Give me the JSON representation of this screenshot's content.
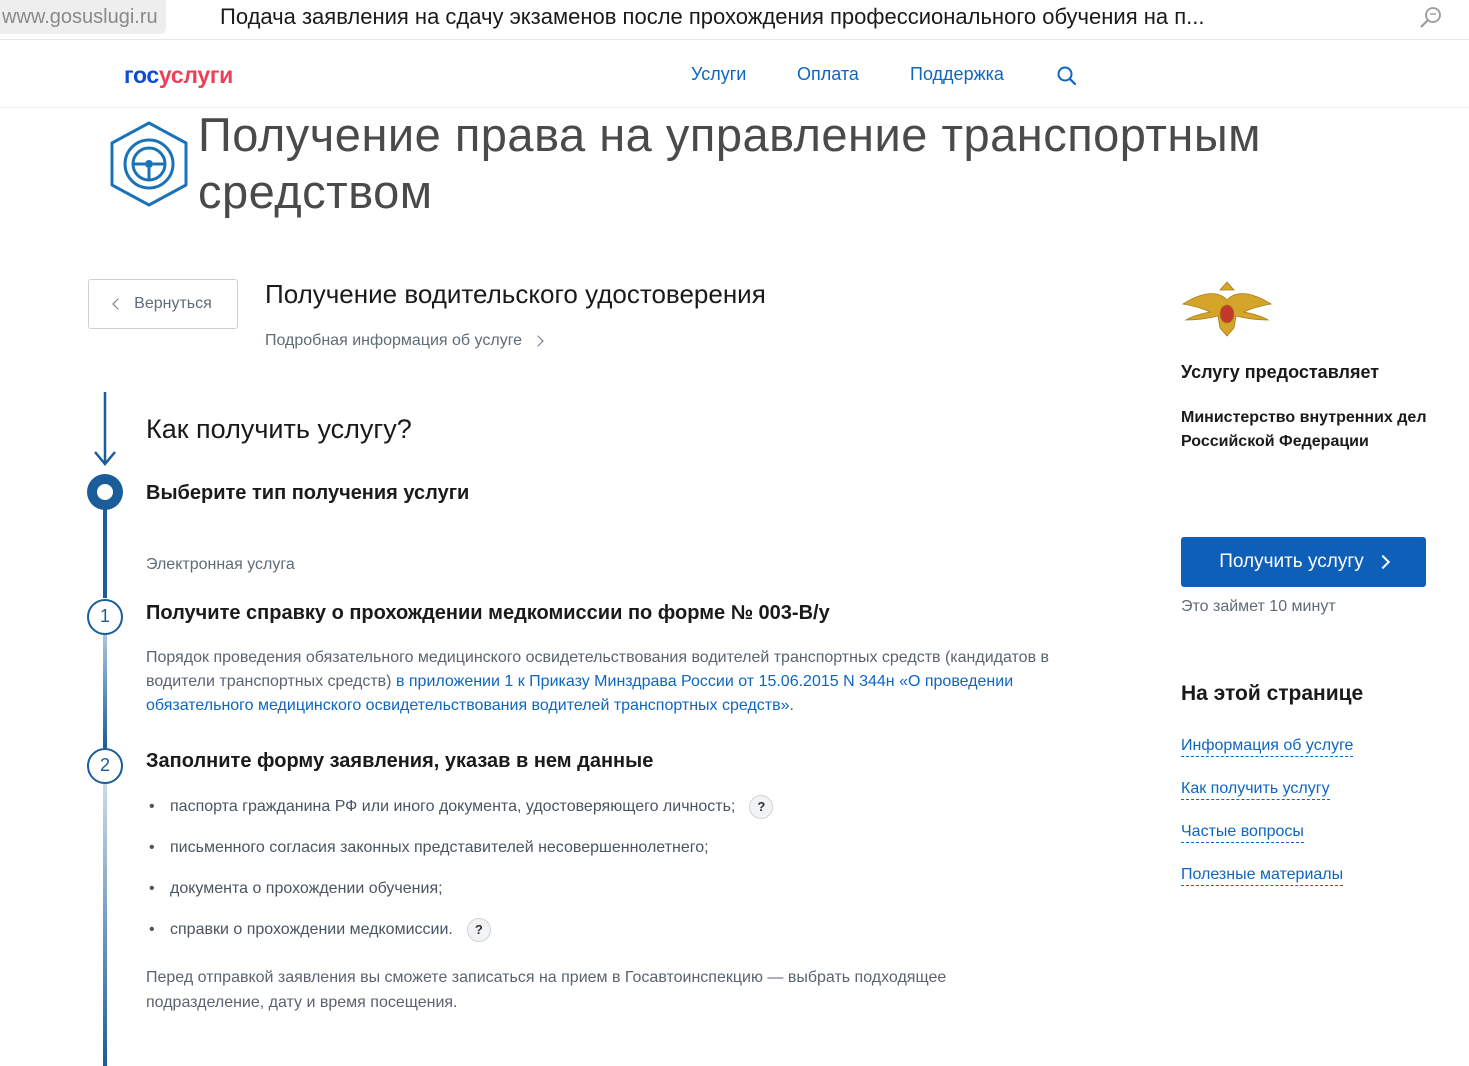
{
  "browser": {
    "domain": "www.gosuslugi.ru",
    "tab_title": "Подача заявления на сдачу экзаменов после прохождения профессионального обучения на п...",
    "icons": [
      "search-icon"
    ]
  },
  "header": {
    "logo_part1": "гос",
    "logo_part2": "услуги",
    "nav": [
      "Услуги",
      "Оплата",
      "Поддержка"
    ],
    "icons": [
      "search-icon"
    ]
  },
  "page": {
    "title": "Получение права на управление транспортным средством",
    "icon": "steering-wheel-icon"
  },
  "service": {
    "back_label": "Вернуться",
    "title": "Получение водительского удостоверения",
    "detail_link": "Подробная информация об услуге"
  },
  "how": {
    "heading": "Как получить услугу?",
    "choose_title": "Выберите тип получения услуги",
    "type_label": "Электронная услуга",
    "steps": [
      {
        "number": "1",
        "title": "Получите справку о прохождении медкомиссии по форме № 003-В/у",
        "text": "Порядок проведения обязательного медицинского освидетельствования водителей транспортных средств (кандидатов в водители транспортных средств) ",
        "link": "в приложении 1 к Приказу Минздрава России от 15.06.2015 N 344н «О проведении обязательного медицинского освидетельствования водителей транспортных средств»."
      },
      {
        "number": "2",
        "title": "Заполните форму заявления, указав в нем данные",
        "items": [
          "паспорта гражданина РФ или иного документа, удостоверяющего личность;",
          "письменного согласия законных представителей несовершеннолетнего;",
          "документа о прохождении обучения;",
          "справки о прохождении медкомиссии."
        ],
        "help_badge": "?",
        "note": "Перед отправкой заявления вы сможете записаться на прием в Госавтоинспекцию — выбрать подходящее подразделение, дату и время посещения."
      }
    ]
  },
  "sidebar": {
    "emblem": "mvd-emblem-icon",
    "provider_label": "Услугу предоставляет",
    "provider_org": "Министерство внутренних дел Российской Федерации",
    "get_button": "Получить услугу",
    "time_note": "Это займет 10 минут",
    "toc_heading": "На этой странице",
    "toc": [
      "Информация об услуге",
      "Как получить услугу",
      "Частые вопросы",
      "Полезные материалы"
    ]
  },
  "colors": {
    "accent_blue": "#0d5fb8",
    "link_blue": "#0d66c2",
    "timeline": "#1a5d9a",
    "logo_red": "#ee3f58",
    "logo_blue": "#0d4cd3"
  }
}
